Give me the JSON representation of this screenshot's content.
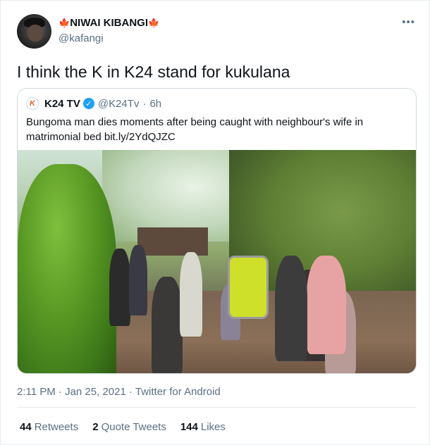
{
  "author": {
    "display_name": "NIWAI KIBANGI",
    "flag_emoji": "🍁",
    "handle": "@kafangi"
  },
  "more_icon": "more-horizontal-icon",
  "tweet": {
    "text": "I think the K in K24 stand for kukulana"
  },
  "quoted": {
    "logo_letter": "K",
    "name": "K24 TV",
    "verified_icon": "verified-badge-icon",
    "handle": "@K24Tv",
    "separator": "·",
    "time": "6h",
    "text": "Bungoma man dies moments after being caught with neighbour's wife in matrimonial bed bit.ly/2YdQJZC"
  },
  "meta": {
    "timestamp": "2:11 PM · Jan 25, 2021 · Twitter for Android"
  },
  "stats": {
    "retweets_count": "44",
    "retweets_label": "Retweets",
    "quotes_count": "2",
    "quotes_label": "Quote Tweets",
    "likes_count": "144",
    "likes_label": "Likes"
  },
  "colors": {
    "link": "#1da1f2",
    "muted": "#5b7083",
    "flag": "#e0245e"
  }
}
